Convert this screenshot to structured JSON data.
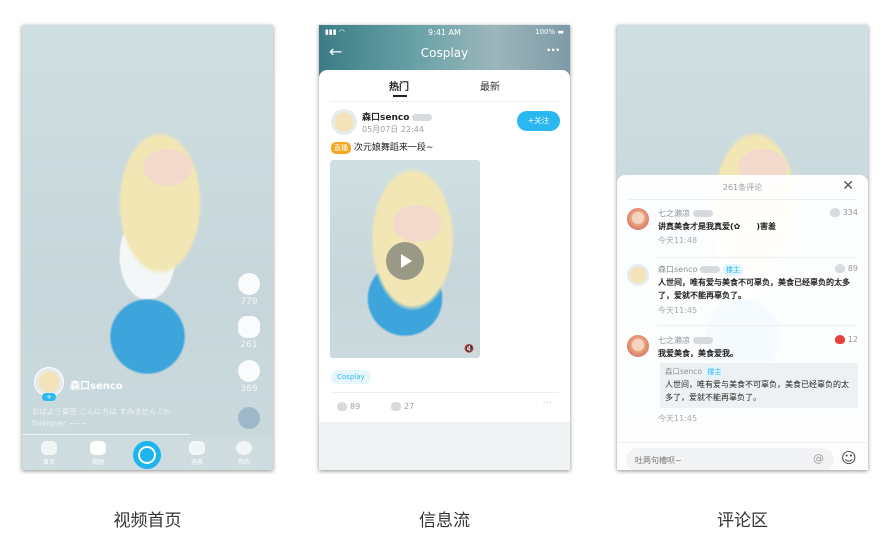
{
  "screens": {
    "video_home": {
      "caption": "视频首页",
      "author": "森口senco",
      "description": "おはよう東京 こんにちは すみません I'm foreigner ~~~",
      "likes": "779",
      "comments": "261",
      "shares": "369",
      "follow_label": "+",
      "nav": [
        {
          "label": "首页",
          "icon": "home-icon"
        },
        {
          "label": "视频",
          "icon": "video-icon"
        },
        {
          "label": "",
          "icon": "camera-icon"
        },
        {
          "label": "消息",
          "icon": "message-icon"
        },
        {
          "label": "我的",
          "icon": "profile-icon"
        }
      ]
    },
    "feed": {
      "caption": "信息流",
      "status": {
        "time": "9:41 AM",
        "battery": "100%"
      },
      "title": "Cosplay",
      "tabs": [
        {
          "label": "热门",
          "active": true
        },
        {
          "label": "最新",
          "active": false
        }
      ],
      "post": {
        "author": "森口senco",
        "level": "1",
        "date": "05月07日 22:44",
        "follow_label": "+关注",
        "badge": "直播",
        "text": "次元娘舞蹈来一段~",
        "topic": "Cosplay",
        "likes": "89",
        "comments": "27"
      }
    },
    "comments": {
      "caption": "评论区",
      "header": "261条评论",
      "items": [
        {
          "user": "七之濑凉",
          "level": "1",
          "text": "讲真美食才是我真爱(✿　　)害羞",
          "time": "今天11:48",
          "likes": "334",
          "liked": false
        },
        {
          "user": "森口senco",
          "level": "1",
          "badge": "楼主",
          "text": "人世间，唯有爱与美食不可辜负，美食已经辜负的太多了，爱就不能再辜负了。",
          "time": "今天11:45",
          "likes": "89",
          "liked": false
        },
        {
          "user": "七之濑凉",
          "level": "1",
          "text": "我爱美食，美食爱我。",
          "time": "今天11:45",
          "likes": "12",
          "liked": true,
          "quote": {
            "user": "森口senco",
            "badge": "楼主",
            "text": "人世间，唯有爱与美食不可辜负，美食已经辜负的太多了，爱就不能再辜负了。"
          }
        }
      ],
      "input_placeholder": "吐两句槽呗~"
    }
  },
  "colors": {
    "accent": "#2bb8f0",
    "like": "#e8413c",
    "badge": "#f5a623"
  }
}
